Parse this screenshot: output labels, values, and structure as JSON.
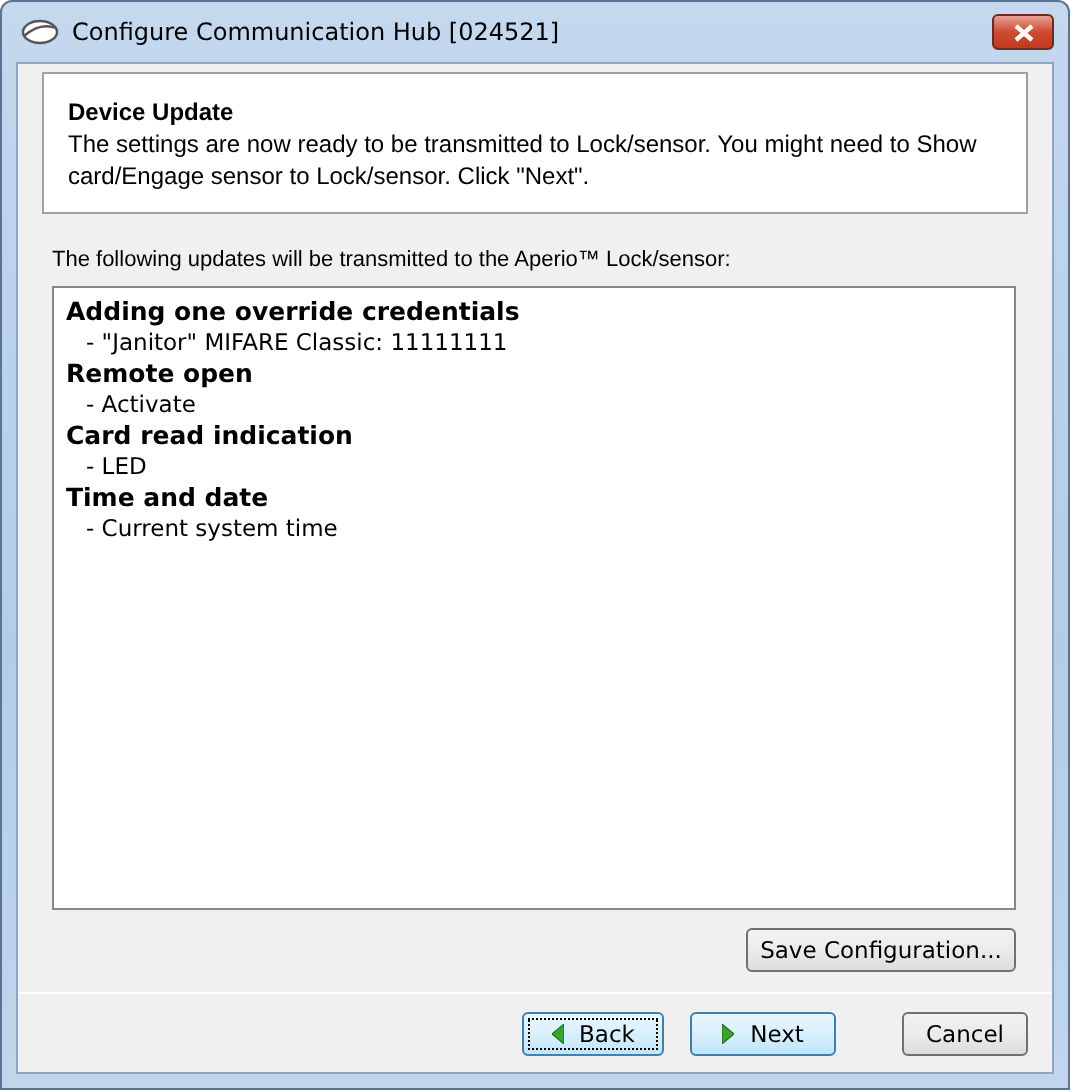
{
  "window": {
    "title": "Configure Communication Hub [024521]"
  },
  "header": {
    "title": "Device Update",
    "text": "The settings are now ready to be transmitted to Lock/sensor. You might need to Show card/Engage sensor to Lock/sensor. Click \"Next\"."
  },
  "list_label": "The following updates will be transmitted to the Aperio™ Lock/sensor:",
  "updates": [
    {
      "kind": "heading",
      "text": "Adding one override credentials"
    },
    {
      "kind": "detail",
      "text": "- \"Janitor\" MIFARE Classic: 11111111"
    },
    {
      "kind": "heading",
      "text": "Remote open"
    },
    {
      "kind": "detail",
      "text": "- Activate"
    },
    {
      "kind": "heading",
      "text": "Card read indication"
    },
    {
      "kind": "detail",
      "text": "- LED"
    },
    {
      "kind": "heading",
      "text": "Time and date"
    },
    {
      "kind": "detail",
      "text": "- Current system time"
    }
  ],
  "save_button": "Save Configuration...",
  "nav_buttons": [
    {
      "kind": "back",
      "label": "Back",
      "highlighted": true,
      "focused": true
    },
    {
      "kind": "next",
      "label": "Next",
      "highlighted": true,
      "focused": false
    },
    {
      "kind": "cancel",
      "label": "Cancel",
      "highlighted": false,
      "focused": false
    }
  ]
}
